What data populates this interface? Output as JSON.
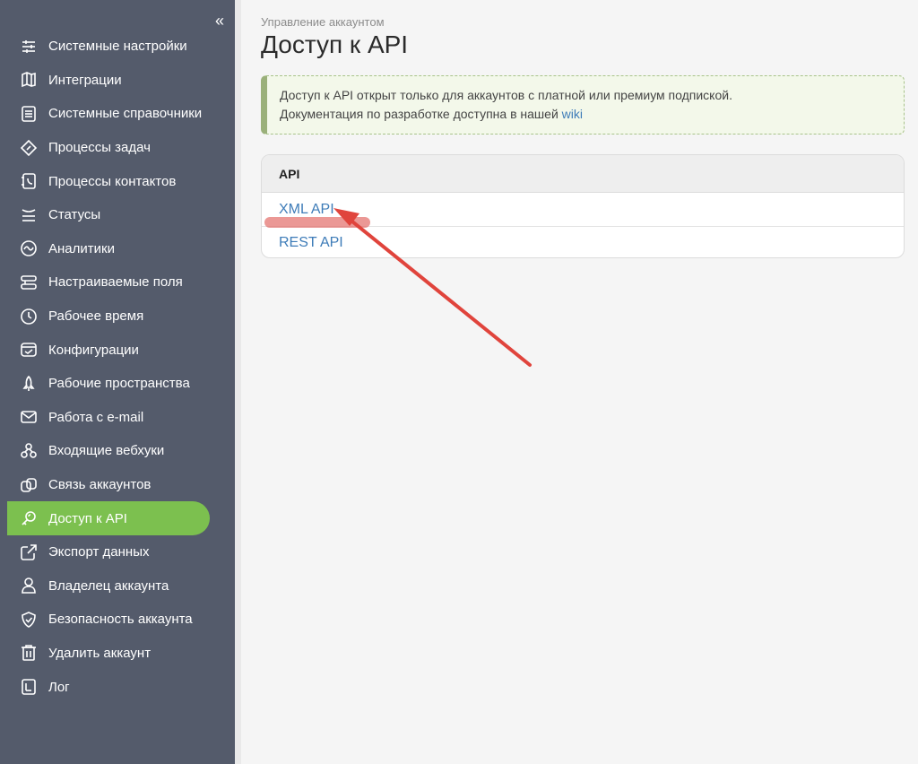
{
  "sidebar": {
    "collapse_icon": "«",
    "items": [
      {
        "label": "Системные настройки",
        "icon": "sliders-icon"
      },
      {
        "label": "Интеграции",
        "icon": "map-icon"
      },
      {
        "label": "Системные справочники",
        "icon": "list-icon"
      },
      {
        "label": "Процессы задач",
        "icon": "diamond-icon"
      },
      {
        "label": "Процессы контактов",
        "icon": "phone-book-icon"
      },
      {
        "label": "Статусы",
        "icon": "status-icon"
      },
      {
        "label": "Аналитики",
        "icon": "analytics-icon"
      },
      {
        "label": "Настраиваемые поля",
        "icon": "fields-icon"
      },
      {
        "label": "Рабочее время",
        "icon": "clock-icon"
      },
      {
        "label": "Конфигурации",
        "icon": "config-icon"
      },
      {
        "label": "Рабочие пространства",
        "icon": "rocket-icon"
      },
      {
        "label": "Работа с e-mail",
        "icon": "mail-icon"
      },
      {
        "label": "Входящие вебхуки",
        "icon": "webhook-icon"
      },
      {
        "label": "Связь аккаунтов",
        "icon": "link-icon"
      },
      {
        "label": "Доступ к API",
        "icon": "key-icon",
        "active": true
      },
      {
        "label": "Экспорт данных",
        "icon": "export-icon"
      },
      {
        "label": "Владелец аккаунта",
        "icon": "user-icon"
      },
      {
        "label": "Безопасность аккаунта",
        "icon": "shield-icon"
      },
      {
        "label": "Удалить аккаунт",
        "icon": "trash-icon"
      },
      {
        "label": "Лог",
        "icon": "log-icon"
      }
    ]
  },
  "main": {
    "breadcrumb": "Управление аккаунтом",
    "title": "Доступ к API",
    "notice": {
      "line1": "Доступ к API открыт только для аккаунтов с платной или премиум подпиской.",
      "line2_prefix": "Документация по разработке доступна в нашей ",
      "link": "wiki"
    },
    "api_table": {
      "header": "API",
      "rows": [
        "XML API",
        "REST API"
      ]
    }
  },
  "colors": {
    "sidebar_bg": "#545b6b",
    "active_item": "#7cc04f",
    "link": "#3e7cb8",
    "annotation": "#e0443c"
  }
}
